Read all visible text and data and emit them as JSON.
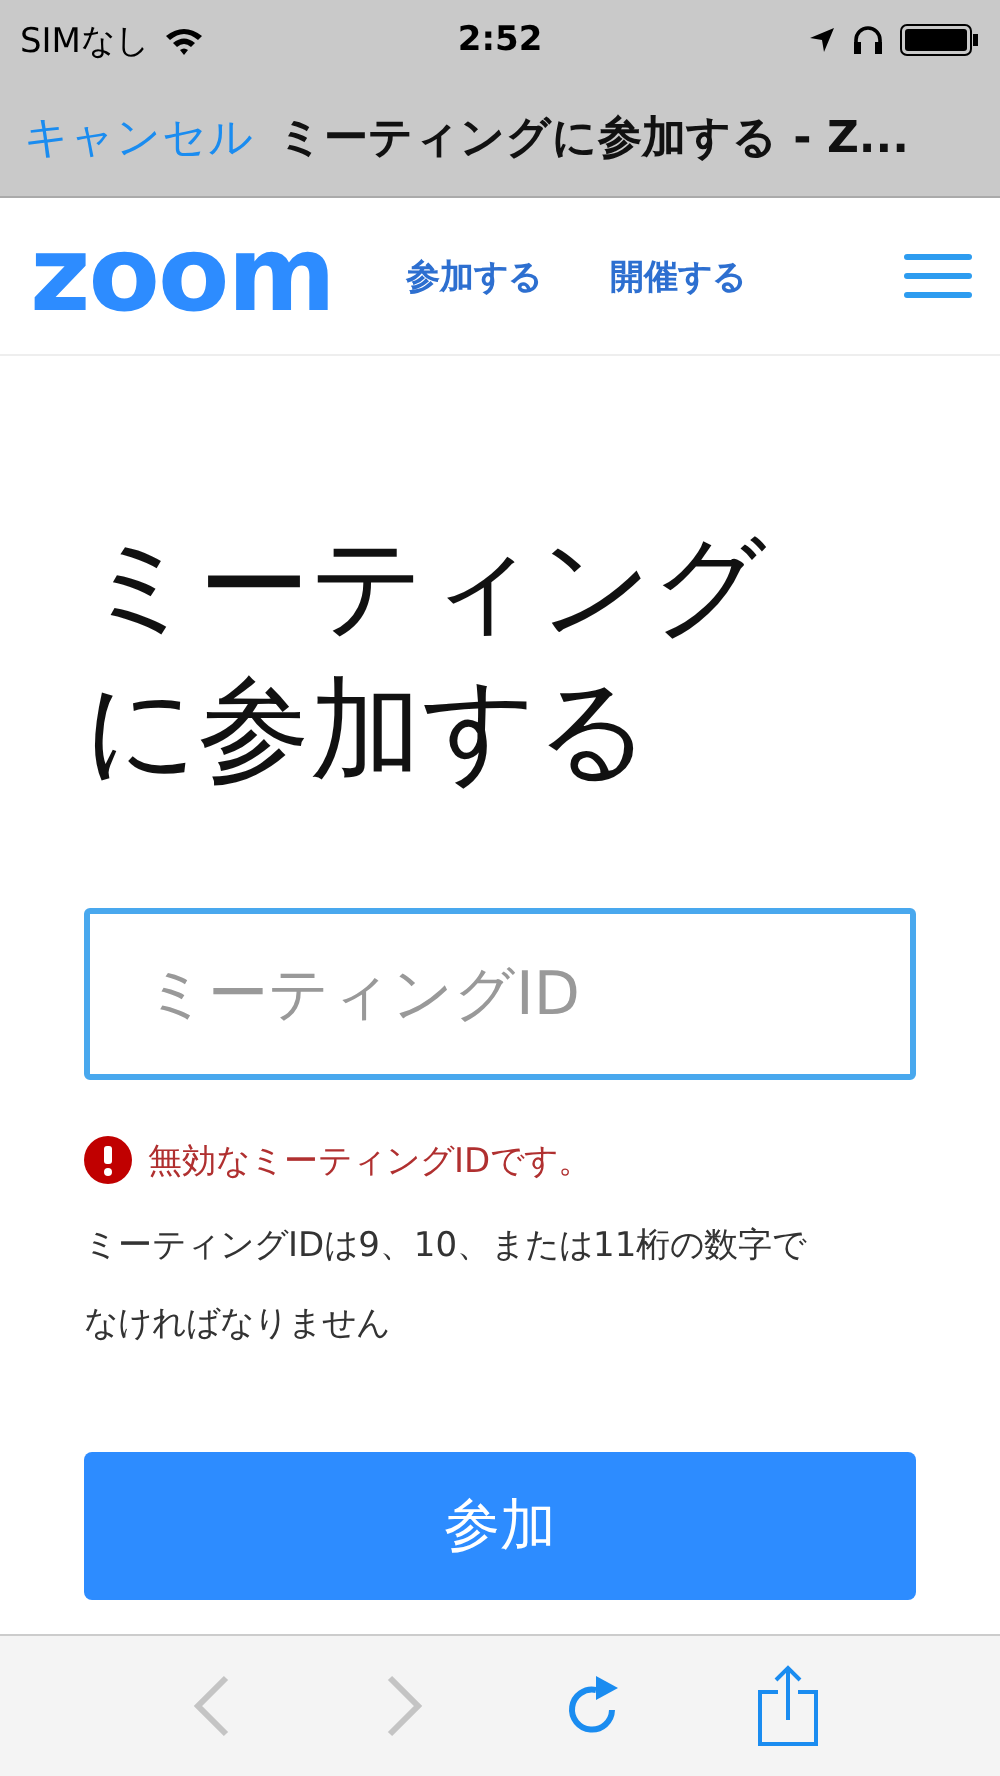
{
  "status_bar": {
    "carrier": "SIMなし",
    "time": "2:52"
  },
  "nav_bar": {
    "cancel": "キャンセル",
    "title": "ミーティングに参加する - Z..."
  },
  "header": {
    "logo": "zoom",
    "links": [
      "参加する",
      "開催する"
    ]
  },
  "heading": "ミーティングに参加する",
  "meeting_id_field": {
    "placeholder": "ミーティングID"
  },
  "error": {
    "message": "無効なミーティングIDです。"
  },
  "hint": "ミーティングIDは9、10、または11桁の数字でなければなりません",
  "join_button": "参加",
  "toolbar": {
    "back": {
      "disabled": true
    },
    "forward": {
      "disabled": true
    }
  }
}
